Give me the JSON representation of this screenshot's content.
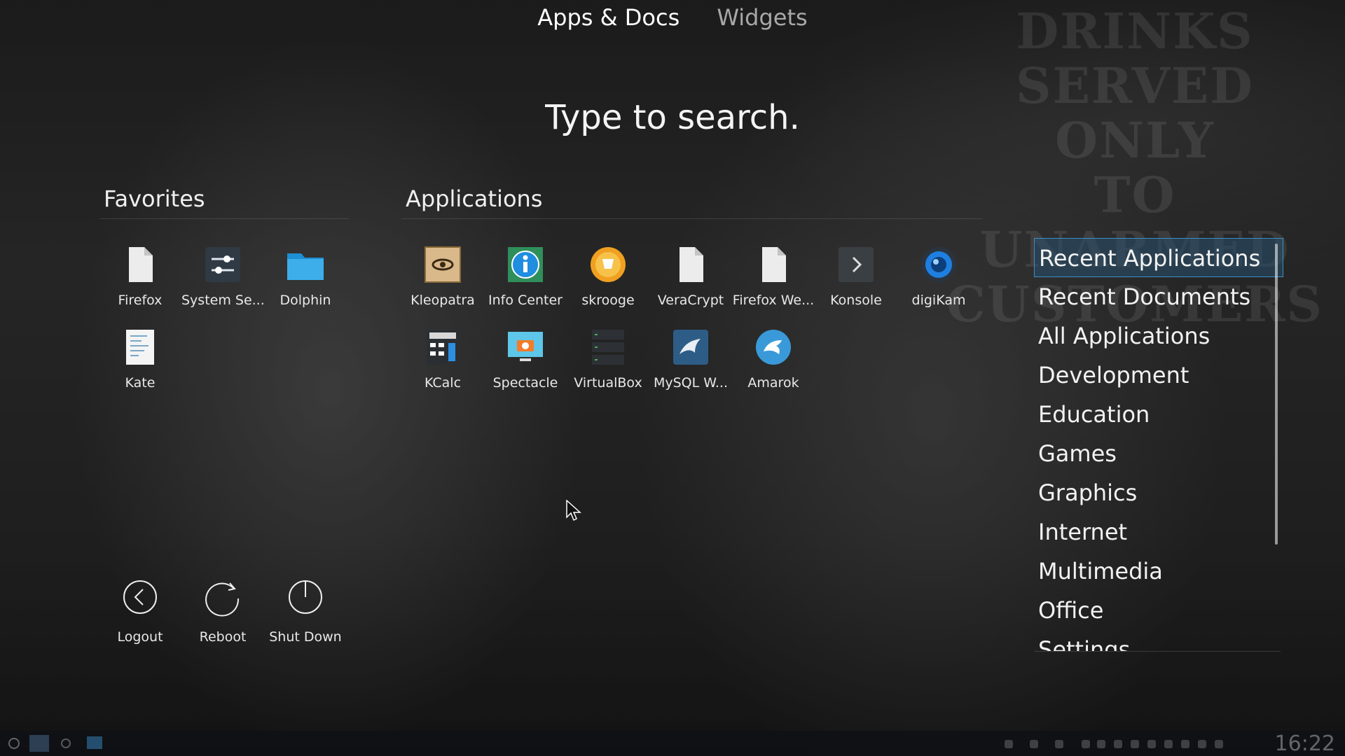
{
  "tabs": [
    {
      "label": "Apps & Docs",
      "active": true
    },
    {
      "label": "Widgets",
      "active": false
    }
  ],
  "search": {
    "hint": "Type to search."
  },
  "favorites": {
    "title": "Favorites",
    "items": [
      {
        "label": "Firefox",
        "icon": "file-icon"
      },
      {
        "label": "System Se...",
        "icon": "system-settings-icon"
      },
      {
        "label": "Dolphin",
        "icon": "folder-icon"
      },
      {
        "label": "Kate",
        "icon": "text-editor-icon"
      }
    ]
  },
  "applications": {
    "title": "Applications",
    "items": [
      {
        "label": "Kleopatra",
        "icon": "kleopatra-icon"
      },
      {
        "label": "Info Center",
        "icon": "info-icon"
      },
      {
        "label": "skrooge",
        "icon": "skrooge-icon"
      },
      {
        "label": "VeraCrypt",
        "icon": "file-icon"
      },
      {
        "label": "Firefox We...",
        "icon": "file-icon"
      },
      {
        "label": "Konsole",
        "icon": "terminal-icon"
      },
      {
        "label": "digiKam",
        "icon": "camera-lens-icon"
      },
      {
        "label": "KCalc",
        "icon": "calculator-icon"
      },
      {
        "label": "Spectacle",
        "icon": "screenshot-icon"
      },
      {
        "label": "VirtualBox",
        "icon": "server-icon"
      },
      {
        "label": "MySQL W...",
        "icon": "dolphin-db-icon"
      },
      {
        "label": "Amarok",
        "icon": "wolf-icon"
      }
    ]
  },
  "power": [
    {
      "label": "Logout",
      "icon": "logout-icon"
    },
    {
      "label": "Reboot",
      "icon": "reboot-icon"
    },
    {
      "label": "Shut Down",
      "icon": "power-icon"
    }
  ],
  "categories": {
    "selected": "Recent Applications",
    "items": [
      "Recent Applications",
      "Recent Documents",
      "All Applications",
      "Development",
      "Education",
      "Games",
      "Graphics",
      "Internet",
      "Multimedia",
      "Office",
      "Settings"
    ]
  },
  "background_text": [
    "DRINKS SERVED",
    "ONLY",
    "TO UNARMED",
    "CUSTOMERS"
  ],
  "taskbar": {
    "clock": "16:22"
  },
  "colors": {
    "accent": "#3b8ec7",
    "selection_bg": "#284f6e",
    "folder": "#3daee9"
  }
}
